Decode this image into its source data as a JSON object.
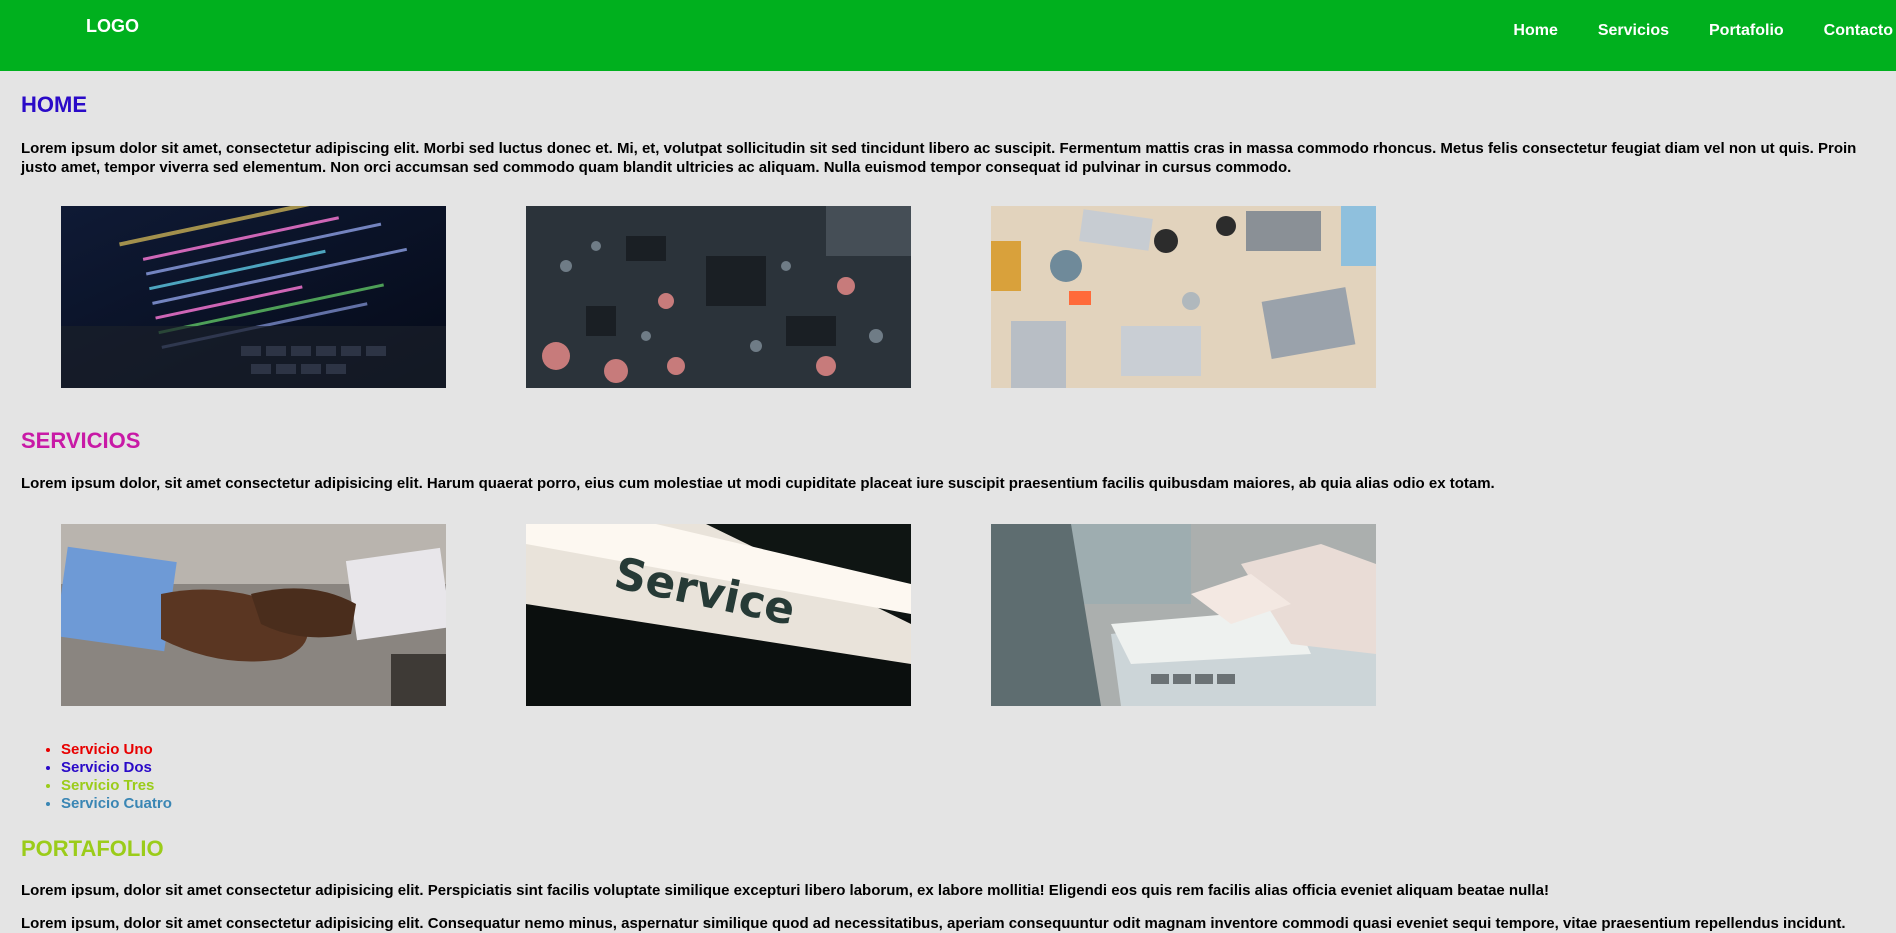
{
  "header": {
    "logo": "LOGO",
    "nav": [
      "Home",
      "Servicios",
      "Portafolio",
      "Contacto"
    ]
  },
  "home": {
    "title": "HOME",
    "text": "Lorem ipsum dolor sit amet, consectetur adipiscing elit. Morbi sed luctus donec et. Mi, et, volutpat sollicitudin sit sed tincidunt libero ac suscipit. Fermentum mattis cras in massa commodo rhoncus. Metus felis consectetur feugiat diam vel non ut quis. Proin justo amet, tempor viverra sed elementum. Non orci accumsan sed commodo quam blandit ultricies ac aliquam. Nulla euismod tempor consequat id pulvinar in cursus commodo.",
    "images": [
      "code-on-laptop-photo",
      "circuit-board-photo",
      "team-laptops-desk-photo"
    ]
  },
  "servicios": {
    "title": "SERVICIOS",
    "text": "Lorem ipsum dolor, sit amet consectetur adipisicing elit. Harum quaerat porro, eius cum molestiae ut modi cupiditate placeat iure suscipit praesentium facilis quibusdam maiores, ab quia alias odio ex totam.",
    "images": [
      "handshake-photo",
      "service-sign-photo",
      "paperwork-laptop-photo"
    ],
    "sign_text": "Service",
    "list": [
      {
        "label": "Servicio Uno",
        "color": "#e80000"
      },
      {
        "label": "Servicio Dos",
        "color": "#2a0ac8"
      },
      {
        "label": "Servicio Tres",
        "color": "#9bcc1a"
      },
      {
        "label": "Servicio Cuatro",
        "color": "#3a86b4"
      }
    ]
  },
  "portafolio": {
    "title": "PORTAFOLIO",
    "text1": "Lorem ipsum, dolor sit amet consectetur adipisicing elit. Perspiciatis sint facilis voluptate similique excepturi libero laborum, ex labore mollitia! Eligendi eos quis rem facilis alias officia eveniet aliquam beatae nulla!",
    "text2": "Lorem ipsum, dolor sit amet consectetur adipisicing elit. Consequatur nemo minus, aspernatur similique quod ad necessitatibus, aperiam consequuntur odit magnam inventore commodi quasi eveniet sequi tempore, vitae praesentium repellendus incidunt."
  },
  "colors": {
    "header_bg": "#00b01e",
    "page_bg": "#e4e4e4",
    "home_title": "#2a0ac8",
    "servicios_title": "#c81aa6",
    "portafolio_title": "#9bcc1a"
  }
}
